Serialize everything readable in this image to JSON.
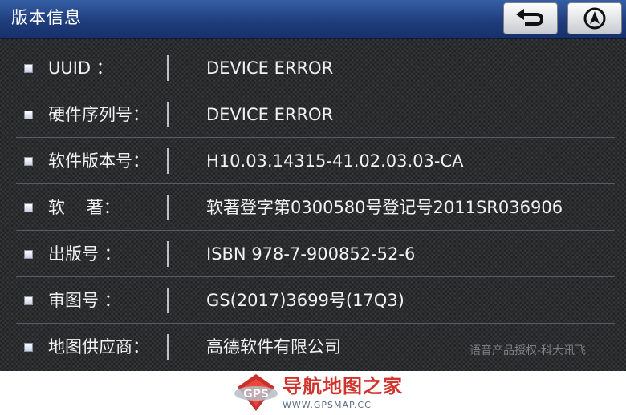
{
  "window": {
    "title": "版本信息"
  },
  "toolbar": {
    "back_icon": "return-arrow-icon",
    "nav_icon": "navigation-icon"
  },
  "rows": [
    {
      "label": "UUID ：",
      "value": "DEVICE ERROR"
    },
    {
      "label": "硬件序列号：",
      "value": "DEVICE ERROR"
    },
    {
      "label": "软件版本号：",
      "value": "H10.03.14315-41.02.03.03-CA"
    },
    {
      "label": "软    著：",
      "value": "软著登字第0300580号登记号2011SR036906"
    },
    {
      "label": "出版号 ：",
      "value": "ISBN 978-7-900852-52-6"
    },
    {
      "label": "审图号 ：",
      "value": "GS(2017)3699号(17Q3)"
    },
    {
      "label": "地图供应商：",
      "value": "高德软件有限公司"
    }
  ],
  "watermark": "语音产品授权-科大讯飞",
  "footer": {
    "site_name": "导航地图之家",
    "site_url": "WWW.GPSMAP.CC",
    "logo_text": "GPS"
  },
  "colors": {
    "titlebar": "#1f3e7c",
    "background": "#2a2c2e",
    "brand_red": "#d0342c"
  }
}
